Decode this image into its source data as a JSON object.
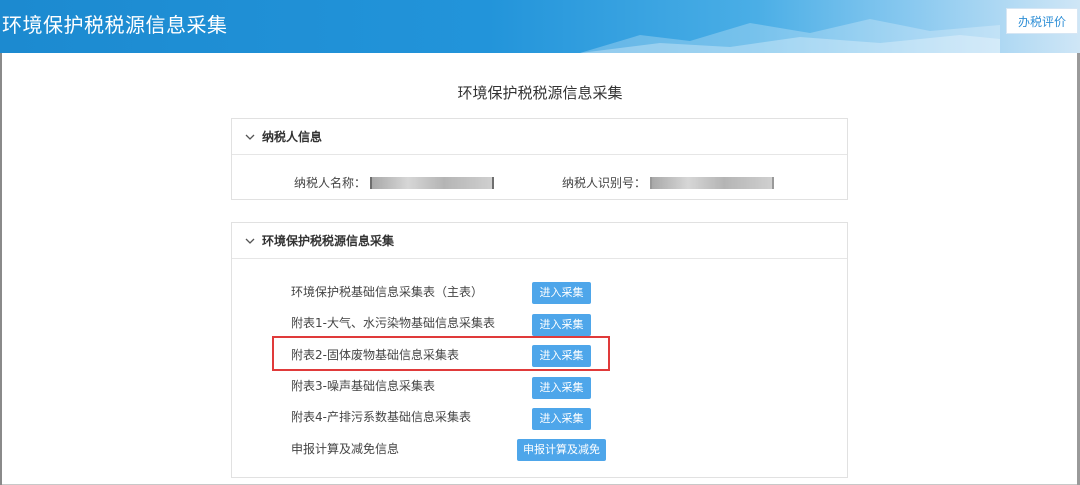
{
  "header": {
    "title": "环境保护税税源信息采集",
    "eval_button": "办税评价"
  },
  "page": {
    "title": "环境保护税税源信息采集"
  },
  "taxpayer_panel": {
    "title": "纳税人信息",
    "name_label": "纳税人名称：",
    "id_label": "纳税人识别号："
  },
  "collection_panel": {
    "title": "环境保护税税源信息采集",
    "items": [
      {
        "label": "环境保护税基础信息采集表（主表）",
        "button": "进入采集"
      },
      {
        "label": "附表1-大气、水污染物基础信息采集表",
        "button": "进入采集"
      },
      {
        "label": "附表2-固体废物基础信息采集表",
        "button": "进入采集"
      },
      {
        "label": "附表3-噪声基础信息采集表",
        "button": "进入采集"
      },
      {
        "label": "附表4-产排污系数基础信息采集表",
        "button": "进入采集"
      },
      {
        "label": "申报计算及减免信息",
        "button": "申报计算及减免"
      }
    ]
  },
  "colors": {
    "header_blue": "#1c8ad0",
    "button_blue": "#4ea6ea",
    "highlight_red": "#e03a3a"
  }
}
